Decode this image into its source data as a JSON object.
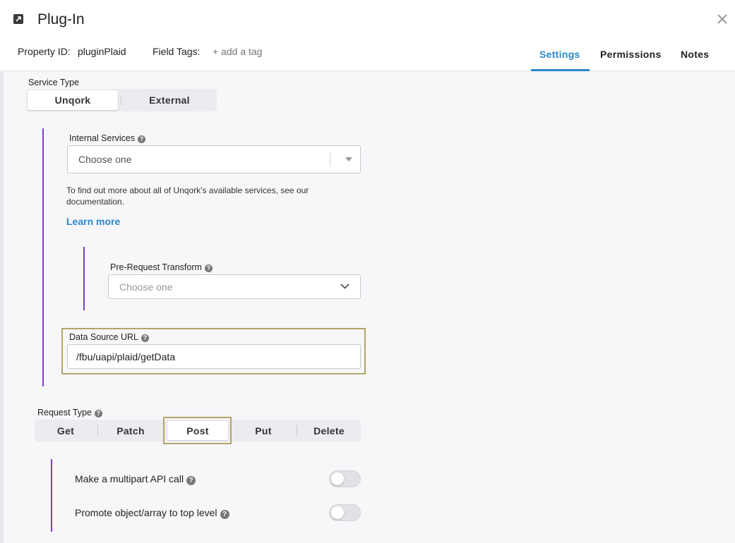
{
  "header": {
    "title": "Plug-In",
    "property_id_label": "Property ID:",
    "property_id_value": "pluginPlaid",
    "field_tags_label": "Field Tags:",
    "field_tags_add": "+ add a tag",
    "tabs": [
      {
        "label": "Settings",
        "active": true
      },
      {
        "label": "Permissions",
        "active": false
      },
      {
        "label": "Notes",
        "active": false
      }
    ]
  },
  "service_type": {
    "label": "Service Type",
    "options": [
      "Unqork",
      "External"
    ],
    "selected": "Unqork"
  },
  "internal_services": {
    "label": "Internal Services",
    "placeholder": "Choose one",
    "help_text": "To find out more about all of Unqork’s available services, see our documentation.",
    "learn_more": "Learn more"
  },
  "pre_request_transform": {
    "label": "Pre-Request Transform",
    "placeholder": "Choose one"
  },
  "data_source_url": {
    "label": "Data Source URL",
    "value": "/fbu/uapi/plaid/getData"
  },
  "request_type": {
    "label": "Request Type",
    "options": [
      "Get",
      "Patch",
      "Post",
      "Put",
      "Delete"
    ],
    "selected": "Post"
  },
  "toggles": [
    {
      "label": "Make a multipart API call",
      "on": false
    },
    {
      "label": "Promote object/array to top level",
      "on": false
    }
  ],
  "colors": {
    "accent": "#2a86c8",
    "indent_line": "#7d3fc7",
    "highlight": "#b5a46a"
  }
}
